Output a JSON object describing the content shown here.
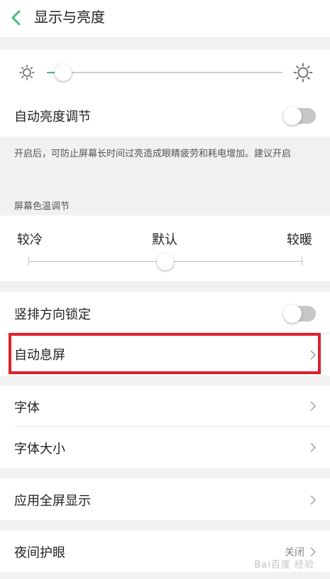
{
  "header": {
    "title": "显示与亮度"
  },
  "brightness": {
    "level_percent": 5,
    "auto_label": "自动亮度调节",
    "auto_enabled": false,
    "note": "开启后，可防止屏幕长时间过亮造成眼睛疲劳和耗电增加。建议开启"
  },
  "color_temp": {
    "section_label": "屏幕色温调节",
    "cold_label": "较冷",
    "default_label": "默认",
    "warm_label": "较暖",
    "level_percent": 50
  },
  "items": {
    "portrait_lock": {
      "label": "竖排方向锁定",
      "enabled": false
    },
    "screen_timeout": {
      "label": "自动息屏"
    },
    "font": {
      "label": "字体"
    },
    "font_size": {
      "label": "字体大小"
    },
    "fullscreen_apps": {
      "label": "应用全屏显示"
    },
    "night_mode": {
      "label": "夜间护眼",
      "value": "关闭"
    }
  },
  "watermark": "Bai百度 经验",
  "colors": {
    "accent": "#3fbe7a",
    "highlight": "#e0202c",
    "toggle_off": "#c7c7c7",
    "background": "#f1f1f1"
  }
}
